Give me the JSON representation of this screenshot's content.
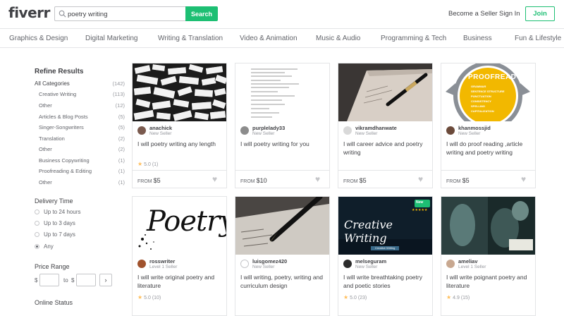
{
  "header": {
    "logo": "fiverr",
    "search_value": "poetry writing",
    "search_button": "Search",
    "become_seller": "Become a Seller",
    "sign_in": "Sign In",
    "join": "Join"
  },
  "categories": [
    "Graphics & Design",
    "Digital Marketing",
    "Writing & Translation",
    "Video & Animation",
    "Music & Audio",
    "Programming & Tech",
    "Business",
    "Fun & Lifestyle"
  ],
  "sidebar": {
    "refine_title": "Refine Results",
    "all_categories": {
      "label": "All Categories",
      "count": "(142)"
    },
    "items": [
      {
        "label": "Creative Writing",
        "count": "(113)"
      },
      {
        "label": "Other",
        "count": "(12)"
      },
      {
        "label": "Articles & Blog Posts",
        "count": "(5)"
      },
      {
        "label": "Singer-Songwriters",
        "count": "(5)"
      },
      {
        "label": "Translation",
        "count": "(2)"
      },
      {
        "label": "Other",
        "count": "(2)"
      },
      {
        "label": "Business Copywriting",
        "count": "(1)"
      },
      {
        "label": "Proofreading & Editing",
        "count": "(1)"
      },
      {
        "label": "Other",
        "count": "(1)"
      }
    ],
    "delivery_title": "Delivery Time",
    "delivery_options": [
      "Up to 24 hours",
      "Up to 3 days",
      "Up to 7 days",
      "Any"
    ],
    "delivery_selected": "Any",
    "price_title": "Price Range",
    "currency": "$",
    "to_label": "to",
    "go": "›",
    "online_title": "Online Status"
  },
  "gigs": [
    {
      "seller": "anachick",
      "level": "New Seller",
      "title": "I will poetry writing any length",
      "rating": "5.0",
      "reviews": "(1)",
      "from": "FROM",
      "price": "$5"
    },
    {
      "seller": "purplelady33",
      "level": "New Seller",
      "title": "I will poetry writing for you",
      "rating": "",
      "reviews": "",
      "from": "FROM",
      "price": "$10"
    },
    {
      "seller": "vikramdhanwate",
      "level": "New Seller",
      "title": "I will career advice and poetry writing",
      "rating": "",
      "reviews": "",
      "from": "FROM",
      "price": "$5"
    },
    {
      "seller": "khanmossjid",
      "level": "New Seller",
      "title": "I will do proof reading ,article writing and poetry writing",
      "rating": "",
      "reviews": "",
      "from": "FROM",
      "price": "$5"
    },
    {
      "seller": "rosswriter",
      "level": "Level 1 Seller",
      "title": "I will write original poetry and literature",
      "rating": "5.0",
      "reviews": "(10)",
      "from": "FROM",
      "price": "$5"
    },
    {
      "seller": "luisgomez420",
      "level": "New Seller",
      "title": "I will writing, poetry, writing and curriculum design",
      "rating": "",
      "reviews": "",
      "from": "FROM",
      "price": "$5"
    },
    {
      "seller": "melseguram",
      "level": "New Seller",
      "title": "I will write breathtaking poetry and poetic stories",
      "rating": "5.0",
      "reviews": "(23)",
      "from": "FROM",
      "price": "$5"
    },
    {
      "seller": "ameliav",
      "level": "Level 1 Seller",
      "title": "I will write poignant poetry and literature",
      "rating": "4.9",
      "reviews": "(15)",
      "from": "FROM",
      "price": "$5"
    }
  ],
  "images": {
    "proofread_title": "PROOFREAD",
    "proofread_lines": [
      "GRAMMAR",
      "SENTENCE STRUCTURE",
      "PUNCTUATION",
      "CONSISTENCY",
      "SPELLING",
      "CAPITALIZATION"
    ],
    "poetry_word": "Poetry",
    "creative_word": "Creative Writing",
    "creative_sub": "Creative Writing",
    "badge_label": "New",
    "badge_stars": "★★★★★"
  },
  "colors": {
    "brand": "#1dbf73",
    "text": "#404145",
    "muted": "#95979d",
    "star": "#ffbe5b"
  }
}
